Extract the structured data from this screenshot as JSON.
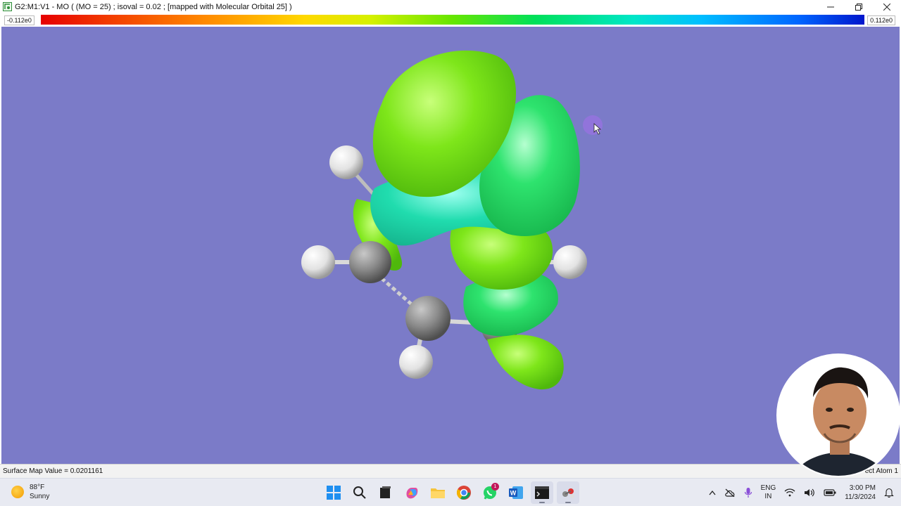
{
  "window": {
    "title": "G2:M1:V1 - MO ( (MO = 25) ; isoval = 0.02 ; [mapped with Molecular Orbital 25] )",
    "controls": [
      "minimize",
      "restore",
      "close"
    ]
  },
  "color_scale": {
    "min_label": "-0.112e0",
    "max_label": "0.112e0"
  },
  "status": {
    "left": "Surface Map Value = 0.0201161",
    "right": "ect Atom 1"
  },
  "taskbar": {
    "weather": {
      "temp": "88°F",
      "condition": "Sunny"
    },
    "apps": [
      {
        "name": "windows-start",
        "icon": "start-icon"
      },
      {
        "name": "search",
        "icon": "search-icon"
      },
      {
        "name": "file-explorer-dark",
        "icon": "terminal-icon"
      },
      {
        "name": "copilot",
        "icon": "copilot-icon"
      },
      {
        "name": "file-explorer",
        "icon": "folder-icon"
      },
      {
        "name": "chrome",
        "icon": "chrome-icon"
      },
      {
        "name": "whatsapp",
        "icon": "whatsapp-icon",
        "badge": "1"
      },
      {
        "name": "word",
        "icon": "word-icon"
      },
      {
        "name": "gaussview-console",
        "icon": "console-icon"
      },
      {
        "name": "gaussview",
        "icon": "gaussview-icon"
      }
    ],
    "language": {
      "line1": "ENG",
      "line2": "IN"
    },
    "clock": {
      "time": "3:00 PM",
      "date": "11/3/2024"
    }
  },
  "colors": {
    "viewport_bg": "#7b7bc8",
    "lobe_yellow_green": "#7ee61a",
    "lobe_green": "#2ee36e",
    "lobe_cyan": "#1fd8b0"
  }
}
